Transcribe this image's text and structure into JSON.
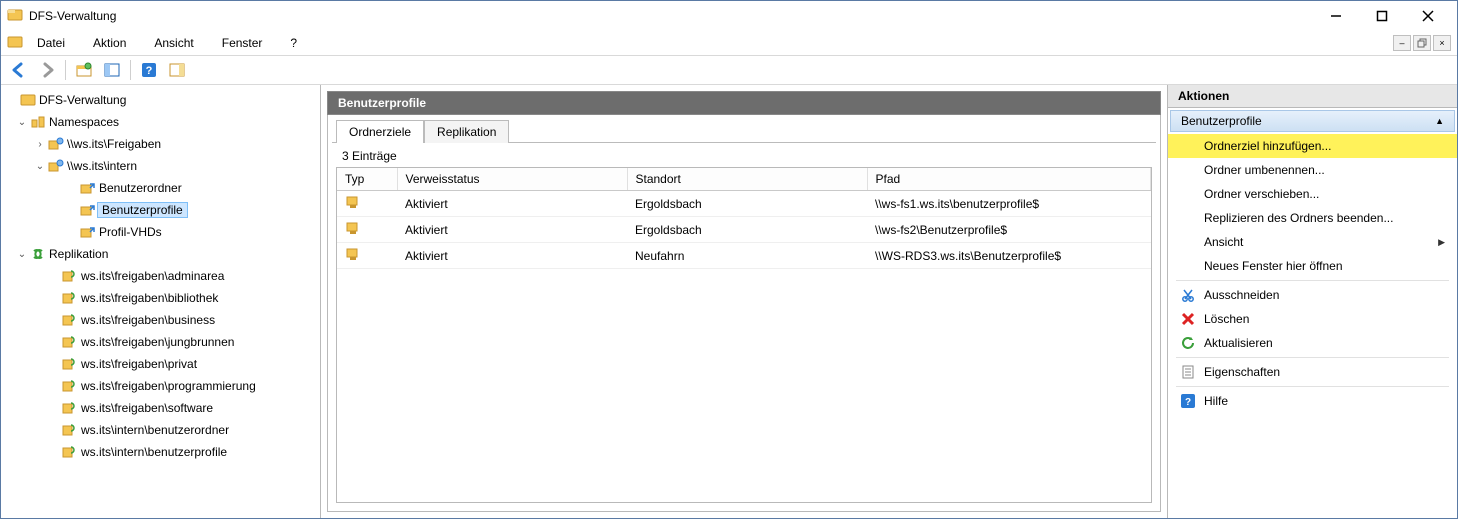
{
  "window": {
    "title": "DFS-Verwaltung"
  },
  "menu": {
    "items": [
      "Datei",
      "Aktion",
      "Ansicht",
      "Fenster",
      "?"
    ]
  },
  "tree": {
    "root": "DFS-Verwaltung",
    "namespaces_label": "Namespaces",
    "ns1": "\\\\ws.its\\Freigaben",
    "ns2": "\\\\ws.its\\intern",
    "ns2_children": [
      "Benutzerordner",
      "Benutzerprofile",
      "Profil-VHDs"
    ],
    "replication_label": "Replikation",
    "repl_items": [
      "ws.its\\freigaben\\adminarea",
      "ws.its\\freigaben\\bibliothek",
      "ws.its\\freigaben\\business",
      "ws.its\\freigaben\\jungbrunnen",
      "ws.its\\freigaben\\privat",
      "ws.its\\freigaben\\programmierung",
      "ws.its\\freigaben\\software",
      "ws.its\\intern\\benutzerordner",
      "ws.its\\intern\\benutzerprofile"
    ]
  },
  "center": {
    "title": "Benutzerprofile",
    "tabs": [
      "Ordnerziele",
      "Replikation"
    ],
    "count_text": "3 Einträge",
    "columns": [
      "Typ",
      "Verweisstatus",
      "Standort",
      "Pfad"
    ],
    "rows": [
      {
        "status": "Aktiviert",
        "site": "Ergoldsbach",
        "path": "\\\\ws-fs1.ws.its\\benutzerprofile$"
      },
      {
        "status": "Aktiviert",
        "site": "Ergoldsbach",
        "path": "\\\\ws-fs2\\Benutzerprofile$"
      },
      {
        "status": "Aktiviert",
        "site": "Neufahrn",
        "path": "\\\\WS-RDS3.ws.its\\Benutzerprofile$"
      }
    ]
  },
  "actions": {
    "header": "Aktionen",
    "group": "Benutzerprofile",
    "items": [
      {
        "label": "Ordnerziel hinzufügen...",
        "icon": null,
        "hl": true
      },
      {
        "label": "Ordner umbenennen...",
        "icon": null
      },
      {
        "label": "Ordner verschieben...",
        "icon": null
      },
      {
        "label": "Replizieren des Ordners beenden...",
        "icon": null
      },
      {
        "label": "Ansicht",
        "icon": null,
        "submenu": true
      },
      {
        "label": "Neues Fenster hier öffnen",
        "icon": null
      },
      {
        "label": "Ausschneiden",
        "icon": "scissors"
      },
      {
        "label": "Löschen",
        "icon": "delete"
      },
      {
        "label": "Aktualisieren",
        "icon": "refresh"
      },
      {
        "label": "Eigenschaften",
        "icon": "properties"
      },
      {
        "label": "Hilfe",
        "icon": "help"
      }
    ]
  }
}
